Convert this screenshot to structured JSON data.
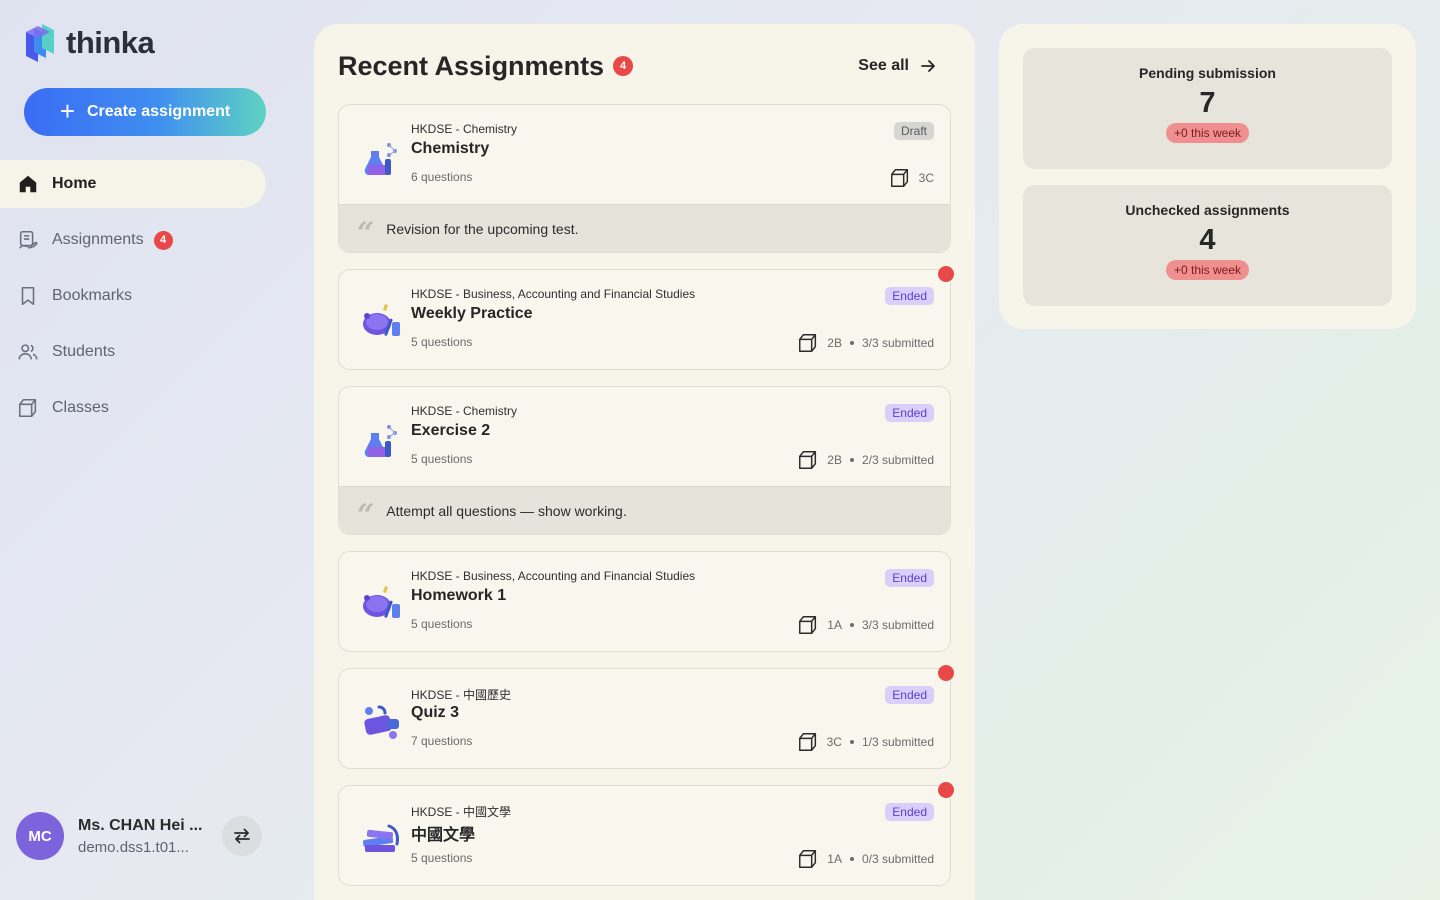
{
  "app": {
    "name": "thinka"
  },
  "sidebar": {
    "create_label": "Create assignment",
    "items": [
      {
        "label": "Home",
        "icon": "home-icon"
      },
      {
        "label": "Assignments",
        "icon": "assignments-icon",
        "badge": "4"
      },
      {
        "label": "Bookmarks",
        "icon": "bookmark-icon"
      },
      {
        "label": "Students",
        "icon": "students-icon"
      },
      {
        "label": "Classes",
        "icon": "classes-icon"
      }
    ],
    "active": "Home",
    "user": {
      "initials": "MC",
      "name": "Ms. CHAN Hei ...",
      "email": "demo.dss1.t01..."
    }
  },
  "main": {
    "title": "Recent Assignments",
    "title_badge": "4",
    "see_all_label": "See all",
    "assignments": [
      {
        "subject": "HKDSE - Chemistry",
        "title": "Chemistry",
        "questions": "6 questions",
        "status": "Draft",
        "class": "3C",
        "submitted": "",
        "note": "Revision for the upcoming test.",
        "unread": false,
        "thumb": "chemistry-flask-icon"
      },
      {
        "subject": "HKDSE - Business, Accounting and Financial Studies",
        "title": "Weekly Practice",
        "questions": "5 questions",
        "status": "Ended",
        "class": "2B",
        "submitted": "3/3 submitted",
        "note": "",
        "unread": true,
        "thumb": "piggy-bank-icon"
      },
      {
        "subject": "HKDSE - Chemistry",
        "title": "Exercise 2",
        "questions": "5 questions",
        "status": "Ended",
        "class": "2B",
        "submitted": "2/3 submitted",
        "note": "Attempt all questions — show working.",
        "unread": false,
        "thumb": "chemistry-flask-icon"
      },
      {
        "subject": "HKDSE - Business, Accounting and Financial Studies",
        "title": "Homework 1",
        "questions": "5 questions",
        "status": "Ended",
        "class": "1A",
        "submitted": "3/3 submitted",
        "note": "",
        "unread": false,
        "thumb": "piggy-bank-icon"
      },
      {
        "subject": "HKDSE - 中國歷史",
        "title": "Quiz 3",
        "questions": "7 questions",
        "status": "Ended",
        "class": "3C",
        "submitted": "1/3 submitted",
        "note": "",
        "unread": true,
        "thumb": "history-scroll-icon"
      },
      {
        "subject": "HKDSE - 中國文學",
        "title": "中國文學",
        "questions": "5 questions",
        "status": "Ended",
        "class": "1A",
        "submitted": "0/3 submitted",
        "note": "",
        "unread": true,
        "thumb": "books-icon"
      }
    ]
  },
  "stats": [
    {
      "label": "Pending submission",
      "value": "7",
      "trend": "+0 this week"
    },
    {
      "label": "Unchecked assignments",
      "value": "4",
      "trend": "+0 this week"
    }
  ],
  "colors": {
    "accent": "#3a6cf4",
    "badge": "#e84848",
    "ended_bg": "#d9d0fa",
    "ended_text": "#5a3fd0",
    "avatar": "#7d64dc"
  }
}
